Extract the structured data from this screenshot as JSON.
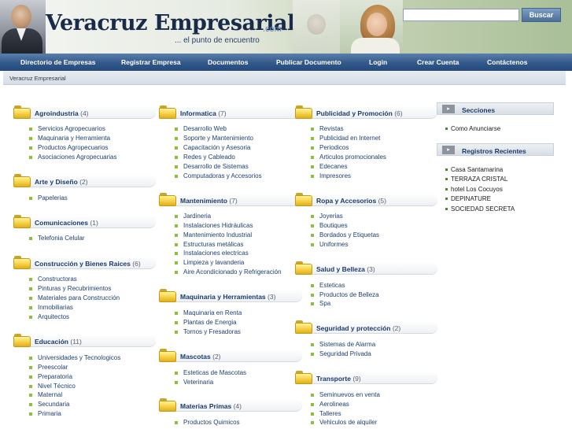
{
  "header": {
    "site_title": "Veracruz Empresarial",
    "site_suffix": ".com",
    "tagline": "... el punto de encuentro",
    "search_placeholder": "",
    "search_button": "Buscar"
  },
  "nav": [
    "Directorio de Empresas",
    "Registrar Empresa",
    "Documentos",
    "Publicar Documento",
    "Login",
    "Crear Cuenta",
    "Contáctenos"
  ],
  "breadcrumb": "Veracruz Empresarial",
  "columns": [
    [
      {
        "name": "Agroindustria",
        "count": "(4)",
        "items": [
          "Servicios Agropecuarios",
          "Maquinaria y Herramienta",
          "Productos Agropecuarios",
          "Asociaciones Agropecuarias"
        ]
      },
      {
        "name": "Arte y Diseño",
        "count": "(2)",
        "items": [
          "Papelerias"
        ]
      },
      {
        "name": "Comunicaciones",
        "count": "(1)",
        "items": [
          "Telefonia Celular"
        ]
      },
      {
        "name": "Construcción y Bienes Raices",
        "count": "(6)",
        "items": [
          "Constructoras",
          "Pinturas y Recubrimientos",
          "Materiales para Construcción",
          "Inmobiliarias",
          "Arquitectos"
        ]
      },
      {
        "name": "Educación",
        "count": "(11)",
        "items": [
          "Universidades y Tecnologicos",
          "Preescolar",
          "Preparatoria",
          "Nivel Técnico",
          "Maternal",
          "Secundaria",
          "Primaria"
        ]
      }
    ],
    [
      {
        "name": "Informatica",
        "count": "(7)",
        "items": [
          "Desarrollo Web",
          "Soporte y Mantenimiento",
          "Capacitación y Asesoria",
          "Redes y Cableado",
          "Desarrollo de Sistemas",
          "Computadoras y Accesorios"
        ]
      },
      {
        "name": "Mantenimiento",
        "count": "(7)",
        "items": [
          "Jardineria",
          "Instalaciones Hidráulicas",
          "Mantenimiento Industrial",
          "Estructuras metálicas",
          "Instalaciones electricas",
          "Limpieza y lavanderia",
          "Aire Acondicionado y Refrigeración"
        ]
      },
      {
        "name": "Maquinaria y Herramientas",
        "count": "(3)",
        "items": [
          "Maquinaria en Renta",
          "Plantas de Energia",
          "Tornos y Fresadoras"
        ]
      },
      {
        "name": "Mascotas",
        "count": "(2)",
        "items": [
          "Esteticas de Mascotas",
          "Veterinaria"
        ]
      },
      {
        "name": "Materias Primas",
        "count": "(4)",
        "items": [
          "Productos Quimicos"
        ]
      }
    ],
    [
      {
        "name": "Publicidad y Promoción",
        "count": "(6)",
        "items": [
          "Revistas",
          "Publicidad en Internet",
          "Periodicos",
          "Articulos promocionales",
          "Edecanes",
          "Impresores"
        ]
      },
      {
        "name": "Ropa y Accesorios",
        "count": "(5)",
        "items": [
          "Joyerias",
          "Boutiques",
          "Bordados y Etiquetas",
          "Uniformes"
        ]
      },
      {
        "name": "Salud y Belleza",
        "count": "(3)",
        "items": [
          "Esteticas",
          "Productos de Belleza",
          "Spa"
        ]
      },
      {
        "name": "Seguridad y protección",
        "count": "(2)",
        "items": [
          "Sistemas de Alarma",
          "Seguridad Privada"
        ]
      },
      {
        "name": "Transporte",
        "count": "(9)",
        "items": [
          "Seminuevos en venta",
          "Aerolineas",
          "Talleres",
          "Vehiculos de alquiler"
        ]
      }
    ]
  ],
  "sidebar": {
    "sections_title": "Secciones",
    "sections_items": [
      "Como Anunciarse"
    ],
    "recent_title": "Registros Recientes",
    "recent_items": [
      "Casa Santamarina",
      "TERRAZA CRISTAL",
      "hotel Los Cocuyos",
      "DEPINATURE",
      "SOCIEDAD SECRETA"
    ]
  },
  "colors": {
    "nav_bg": "#33598a",
    "bullet": "#8cbf3c",
    "folder": "#f7d34a",
    "link": "#1d3f6e"
  }
}
